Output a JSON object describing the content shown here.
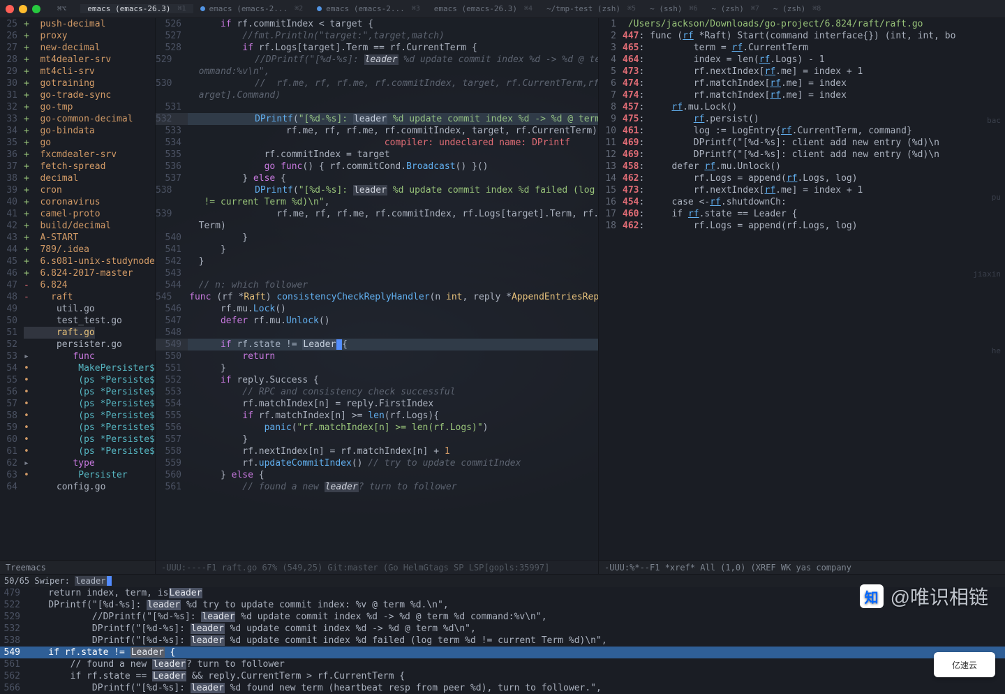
{
  "titlebar": {
    "tabs": [
      {
        "label": "⌘⌥",
        "kbd": ""
      },
      {
        "label": "emacs (emacs-26.3)",
        "kbd": "⌘1",
        "active": true
      },
      {
        "label": "emacs (emacs-2...",
        "kbd": "⌘2",
        "dot": true
      },
      {
        "label": "emacs (emacs-2...",
        "kbd": "⌘3",
        "dot": true
      },
      {
        "label": "emacs (emacs-26.3)",
        "kbd": "⌘4"
      },
      {
        "label": "~/tmp-test (zsh)",
        "kbd": "⌘5"
      },
      {
        "label": "~ (ssh)",
        "kbd": "⌘6"
      },
      {
        "label": "~ (zsh)",
        "kbd": "⌘7"
      },
      {
        "label": "~ (zsh)",
        "kbd": "⌘8"
      }
    ]
  },
  "tree": {
    "modeline": "Treemacs",
    "items": [
      {
        "n": 25,
        "p": "plus",
        "t": "push-decimal"
      },
      {
        "n": 26,
        "p": "plus",
        "t": "proxy"
      },
      {
        "n": 27,
        "p": "plus",
        "t": "new-decimal"
      },
      {
        "n": 28,
        "p": "plus",
        "t": "mt4dealer-srv"
      },
      {
        "n": 29,
        "p": "plus",
        "t": "mt4cli-srv"
      },
      {
        "n": 30,
        "p": "plus",
        "t": "gotraining"
      },
      {
        "n": 31,
        "p": "plus",
        "t": "go-trade-sync"
      },
      {
        "n": 32,
        "p": "plus",
        "t": "go-tmp"
      },
      {
        "n": 33,
        "p": "plus",
        "t": "go-common-decimal"
      },
      {
        "n": 34,
        "p": "plus",
        "t": "go-bindata"
      },
      {
        "n": 35,
        "p": "plus",
        "t": "go"
      },
      {
        "n": 36,
        "p": "plus",
        "t": "fxcmdealer-srv"
      },
      {
        "n": 37,
        "p": "plus",
        "t": "fetch-spread"
      },
      {
        "n": 38,
        "p": "plus",
        "t": "decimal"
      },
      {
        "n": 39,
        "p": "plus",
        "t": "cron"
      },
      {
        "n": 40,
        "p": "plus",
        "t": "coronavirus"
      },
      {
        "n": 41,
        "p": "plus",
        "t": "camel-proto"
      },
      {
        "n": 42,
        "p": "plus",
        "t": "build/decimal"
      },
      {
        "n": 43,
        "p": "plus",
        "t": "A-START"
      },
      {
        "n": 44,
        "p": "plus",
        "t": "789/.idea"
      },
      {
        "n": 45,
        "p": "plus",
        "t": "6.s081-unix-studynode"
      },
      {
        "n": 46,
        "p": "plus",
        "t": "6.824-2017-master"
      },
      {
        "n": 47,
        "p": "minus",
        "t": "6.824"
      },
      {
        "n": 48,
        "p": "minus",
        "t": "raft",
        "pad": "   "
      },
      {
        "n": 49,
        "p": "",
        "t": "util.go",
        "cls": "file",
        "pad": "      "
      },
      {
        "n": 50,
        "p": "",
        "t": "test_test.go",
        "cls": "file",
        "pad": "      "
      },
      {
        "n": 51,
        "p": "",
        "t": "raft.go",
        "cls": "sel",
        "pad": "      "
      },
      {
        "n": 52,
        "p": "",
        "t": "persister.go",
        "cls": "file",
        "pad": "      "
      },
      {
        "n": 53,
        "p": "arrow",
        "t": "func",
        "cls": "fn",
        "pad": "       "
      },
      {
        "n": 54,
        "p": "bullet",
        "t": "MakePersister$",
        "cls": "tp",
        "pad": "        "
      },
      {
        "n": 55,
        "p": "bullet",
        "t": "(ps *Persiste$",
        "cls": "tp",
        "pad": "        "
      },
      {
        "n": 56,
        "p": "bullet",
        "t": "(ps *Persiste$",
        "cls": "tp",
        "pad": "        "
      },
      {
        "n": 57,
        "p": "bullet",
        "t": "(ps *Persiste$",
        "cls": "tp",
        "pad": "        "
      },
      {
        "n": 58,
        "p": "bullet",
        "t": "(ps *Persiste$",
        "cls": "tp",
        "pad": "        "
      },
      {
        "n": 59,
        "p": "bullet",
        "t": "(ps *Persiste$",
        "cls": "tp",
        "pad": "        "
      },
      {
        "n": 60,
        "p": "bullet",
        "t": "(ps *Persiste$",
        "cls": "tp",
        "pad": "        "
      },
      {
        "n": 61,
        "p": "bullet",
        "t": "(ps *Persiste$",
        "cls": "tp",
        "pad": "        "
      },
      {
        "n": 62,
        "p": "arrow",
        "t": "type",
        "cls": "fn",
        "pad": "       "
      },
      {
        "n": 63,
        "p": "bullet",
        "t": "Persister",
        "cls": "tp",
        "pad": "        "
      },
      {
        "n": 64,
        "p": "",
        "t": "config.go",
        "cls": "file",
        "pad": "      "
      }
    ]
  },
  "code": {
    "modeline": "-UUU:----F1  raft.go       67% (549,25)  Git:master  (Go HelmGtags SP LSP[gopls:35997]",
    "lines": [
      {
        "n": 526,
        "html": "    <span class='c-kw'>if</span> rf.commitIndex &lt; target {"
      },
      {
        "n": 527,
        "html": "        <span class='c-cm'>//fmt.Println(\"target:\",target,match)</span>"
      },
      {
        "n": 528,
        "html": "        <span class='c-kw'>if</span> rf.Logs[target].Term == rf.CurrentTerm {"
      },
      {
        "n": 529,
        "html": "            <span class='c-cm'>//DPrintf(\"[%d-%s]: <span class='hl-lead'>leader</span> %d update commit index %d -&gt; %d @ term %d c\\</span>"
      },
      {
        "n": "",
        "html": "<span class='c-cm'>ommand:%v\\n\",</span>"
      },
      {
        "n": 530,
        "html": "            <span class='c-cm'>//  rf.me, rf, rf.me, rf.commitIndex, target, rf.CurrentTerm,rf.Logs[t\\</span>"
      },
      {
        "n": "",
        "html": "<span class='c-cm'>arget].Command)</span>"
      },
      {
        "n": 531,
        "html": ""
      },
      {
        "n": 532,
        "html": "            <span class='c-fn'>DPrintf</span>(<span class='c-str'>\"[%d-%s]:</span> <span class='hl-lead'>leader</span> <span class='c-str'>%d update commit index %d -&gt; %d @ term %d\\n\"</span>,",
        "cursor": true
      },
      {
        "n": 533,
        "html": "                rf.me, rf, rf.me, rf.commitIndex, target, rf.CurrentTerm)"
      },
      {
        "n": 534,
        "html": "                                  <span class='c-err'>compiler: undeclared name: DPrintf</span>"
      },
      {
        "n": 535,
        "html": "            rf.commitIndex = target"
      },
      {
        "n": 536,
        "html": "            <span class='c-kw'>go</span> <span class='c-kw'>func</span>() { rf.commitCond.<span class='c-fn'>Broadcast</span>() }()"
      },
      {
        "n": 537,
        "html": "        } <span class='c-kw'>else</span> {"
      },
      {
        "n": 538,
        "html": "            <span class='c-fn'>DPrintf</span>(<span class='c-str'>\"[%d-%s]:</span> <span class='hl-lead'>leader</span> <span class='c-str'>%d update commit index %d failed (log term %d\\</span>"
      },
      {
        "n": "",
        "html": "<span class='c-str'> != current Term %d)\\n\"</span>,"
      },
      {
        "n": 539,
        "html": "                rf.me, rf, rf.me, rf.commitIndex, rf.Logs[target].Term, rf.Current\\"
      },
      {
        "n": "",
        "html": "Term)"
      },
      {
        "n": 540,
        "html": "        }"
      },
      {
        "n": 541,
        "html": "    }"
      },
      {
        "n": 542,
        "html": "}"
      },
      {
        "n": 543,
        "html": ""
      },
      {
        "n": 544,
        "html": "<span class='c-cm'>// n: which follower</span>"
      },
      {
        "n": 545,
        "html": "<span class='c-kw'>func</span> (rf *<span class='c-ty'>Raft</span>) <span class='c-fn'>consistencyCheckReplyHandler</span>(n <span class='c-ty'>int</span>, reply *<span class='c-ty'>AppendEntriesReply</span>) {"
      },
      {
        "n": 546,
        "html": "    rf.mu.<span class='c-fn'>Lock</span>()"
      },
      {
        "n": 547,
        "html": "    <span class='c-kw'>defer</span> rf.mu.<span class='c-fn'>Unlock</span>()"
      },
      {
        "n": 548,
        "html": ""
      },
      {
        "n": 549,
        "html": "    <span class='c-kw'>if</span> rf.state != <span class='hl-lead'>Leader</span><span style='background:#528bff;'> </span>{",
        "cursor": true
      },
      {
        "n": 550,
        "html": "        <span class='c-kw'>return</span>"
      },
      {
        "n": 551,
        "html": "    }"
      },
      {
        "n": 552,
        "html": "    <span class='c-kw'>if</span> reply.Success {"
      },
      {
        "n": 553,
        "html": "        <span class='c-cm'>// RPC and consistency check successful</span>"
      },
      {
        "n": 554,
        "html": "        rf.matchIndex[n] = reply.FirstIndex"
      },
      {
        "n": 555,
        "html": "        <span class='c-kw'>if</span> rf.matchIndex[n] &gt;= <span class='c-fn'>len</span>(rf.Logs){"
      },
      {
        "n": 556,
        "html": "            <span class='c-fn'>panic</span>(<span class='c-str'>\"rf.matchIndex[n] &gt;= len(rf.Logs)\"</span>)"
      },
      {
        "n": 557,
        "html": "        }"
      },
      {
        "n": 558,
        "html": "        rf.nextIndex[n] = rf.matchIndex[n] + <span class='c-num'>1</span>"
      },
      {
        "n": 559,
        "html": "        rf.<span class='c-fn'>updateCommitIndex</span>() <span class='c-cm'>// try to update commitIndex</span>"
      },
      {
        "n": 560,
        "html": "    } <span class='c-kw'>else</span> {"
      },
      {
        "n": 561,
        "html": "        <span class='c-cm'>// found a new <span class='hl-lead'>leader</span>? turn to follower</span>"
      }
    ]
  },
  "xref": {
    "modeline": "-UUU:%*--F1  *xref*           All (1,0)      (XREF WK yas company",
    "path": "/Users/jackson/Downloads/go-project/6.824/raft/raft.go",
    "ghosts": [
      "bac",
      "pu",
      "jiaxin",
      "he"
    ],
    "items": [
      {
        "i": 2,
        "l": "447",
        "t": ": func (<span class='xref-u'>rf</span> *Raft) Start(command interface{}) (int, int, bo"
      },
      {
        "i": 3,
        "l": "465",
        "t": ":         term = <span class='xref-u'>rf</span>.CurrentTerm"
      },
      {
        "i": 4,
        "l": "464",
        "t": ":         index = len(<span class='xref-u'>rf</span>.Logs) - 1"
      },
      {
        "i": 5,
        "l": "473",
        "t": ":         rf.nextIndex[<span class='xref-u'>rf</span>.me] = index + 1"
      },
      {
        "i": 6,
        "l": "474",
        "t": ":         rf.matchIndex[<span class='xref-u'>rf</span>.me] = index"
      },
      {
        "i": 7,
        "l": "474",
        "t": ":         rf.matchIndex[<span class='xref-u'>rf</span>.me] = index"
      },
      {
        "i": 8,
        "l": "457",
        "t": ":     <span class='xref-u'>rf</span>.mu.Lock()"
      },
      {
        "i": 9,
        "l": "475",
        "t": ":         <span class='xref-u'>rf</span>.persist()"
      },
      {
        "i": 10,
        "l": "461",
        "t": ":         log := LogEntry{<span class='xref-u'>rf</span>.CurrentTerm, command}"
      },
      {
        "i": 11,
        "l": "469",
        "t": ":         DPrintf(\"[%d-%s]: client add new entry (%d)\\n"
      },
      {
        "i": 12,
        "l": "469",
        "t": ":         DPrintf(\"[%d-%s]: client add new entry (%d)\\n"
      },
      {
        "i": 13,
        "l": "458",
        "t": ":     defer <span class='xref-u'>rf</span>.mu.Unlock()"
      },
      {
        "i": 14,
        "l": "462",
        "t": ":         rf.Logs = append(<span class='xref-u'>rf</span>.Logs, log)"
      },
      {
        "i": 15,
        "l": "473",
        "t": ":         rf.nextIndex[<span class='xref-u'>rf</span>.me] = index + 1"
      },
      {
        "i": 16,
        "l": "454",
        "t": ":     case &lt;-<span class='xref-u'>rf</span>.shutdownCh:"
      },
      {
        "i": 17,
        "l": "460",
        "t": ":     if <span class='xref-u'>rf</span>.state == Leader {"
      },
      {
        "i": 18,
        "l": "462",
        "t": ":         rf.Logs = append(rf.Logs, log)"
      }
    ]
  },
  "swiper": {
    "status": "50/65 Swiper: leader",
    "query": "leader",
    "lines": [
      {
        "n": 479,
        "t": "    return index, term, is<span class='lead'>Leader</span>"
      },
      {
        "n": 522,
        "t": "    DPrintf(\"[%d-%s]: <span class='lead'>leader</span> %d try to update commit index: %v @ term %d.\\n\","
      },
      {
        "n": 529,
        "t": "            //DPrintf(\"[%d-%s]: <span class='lead'>leader</span> %d update commit index %d -&gt; %d @ term %d command:%v\\n\","
      },
      {
        "n": 532,
        "t": "            DPrintf(\"[%d-%s]: <span class='lead'>leader</span> %d update commit index %d -&gt; %d @ term %d\\n\","
      },
      {
        "n": 538,
        "t": "            DPrintf(\"[%d-%s]: <span class='lead'>leader</span> %d update commit index %d failed (log term %d != current Term %d)\\n\","
      },
      {
        "n": 549,
        "t": "    if rf.state != <span class='lead'>Leader</span> {",
        "sel": true
      },
      {
        "n": 561,
        "t": "        // found a new <span class='lead'>leader</span>? turn to follower"
      },
      {
        "n": 562,
        "t": "        if rf.state == <span class='lead'>Leader</span> &amp;&amp; reply.CurrentTerm &gt; rf.CurrentTerm {"
      },
      {
        "n": 566,
        "t": "            DPrintf(\"[%d-%s]: <span class='lead'>leader</span> %d found new term (heartbeat resp from peer %d), turn to follower.\","
      }
    ]
  },
  "watermark": {
    "text": "@唯识相链"
  },
  "ysy": "亿速云"
}
